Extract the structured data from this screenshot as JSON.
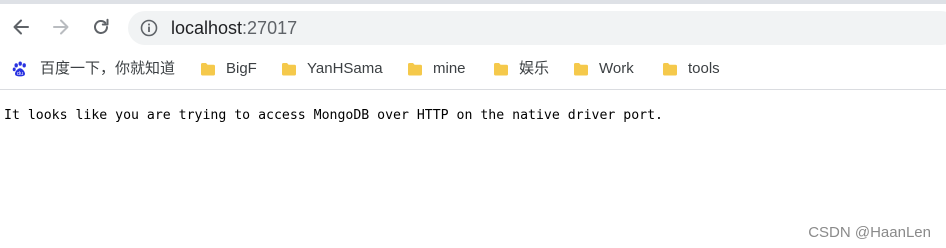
{
  "browser": {
    "url_host": "localhost",
    "url_port": ":27017",
    "icons": {
      "back": "back-arrow-icon",
      "forward": "forward-arrow-icon",
      "reload": "reload-icon",
      "site_info": "info-icon",
      "baidu": "baidu-paw-icon",
      "folder": "folder-icon"
    },
    "colors": {
      "folder": "#f5c94b",
      "baidu": "#2932e1",
      "icon_active": "#5f6368",
      "icon_disabled": "#b9bcc0"
    }
  },
  "bookmarks": [
    {
      "label": "百度一下，你就知道",
      "type": "site"
    },
    {
      "label": "BigF",
      "type": "folder"
    },
    {
      "label": "YanHSama",
      "type": "folder"
    },
    {
      "label": "mine",
      "type": "folder"
    },
    {
      "label": "娱乐",
      "type": "folder"
    },
    {
      "label": "Work",
      "type": "folder"
    },
    {
      "label": "tools",
      "type": "folder"
    }
  ],
  "page": {
    "message": "It looks like you are trying to access MongoDB over HTTP on the native driver port."
  },
  "watermark": "CSDN @HaanLen"
}
